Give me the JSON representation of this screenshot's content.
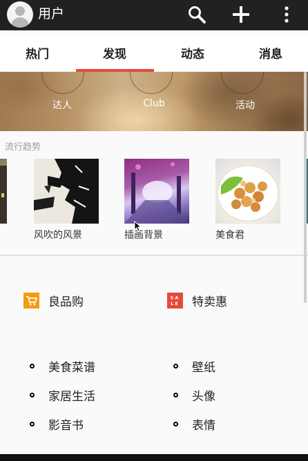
{
  "topbar": {
    "user_name": "用户"
  },
  "tabs": [
    "热门",
    "发现",
    "动态",
    "消息"
  ],
  "selected_tab": "发现",
  "banner": {
    "items": [
      "达人",
      "Club",
      "活动"
    ]
  },
  "trends": {
    "title": "流行趋势",
    "items": [
      {
        "label": "风吹的风景"
      },
      {
        "label": "插画背景"
      },
      {
        "label": "美食君"
      }
    ]
  },
  "shopping": [
    {
      "label": "良品购",
      "icon": "shopping-cart-icon",
      "color": "#f39c12"
    },
    {
      "label": "特卖惠",
      "icon": "sale-icon",
      "color": "#e64a3b",
      "icon_text": "SALE"
    }
  ],
  "categories": {
    "left": [
      "美食菜谱",
      "家居生活",
      "影音书"
    ],
    "right": [
      "壁纸",
      "头像",
      "表情"
    ]
  },
  "colors": {
    "accent": "#e64a3b",
    "topbar_bg": "#212121",
    "dot_green": "#b5d334",
    "dot_blue": "#6ec6e8"
  }
}
